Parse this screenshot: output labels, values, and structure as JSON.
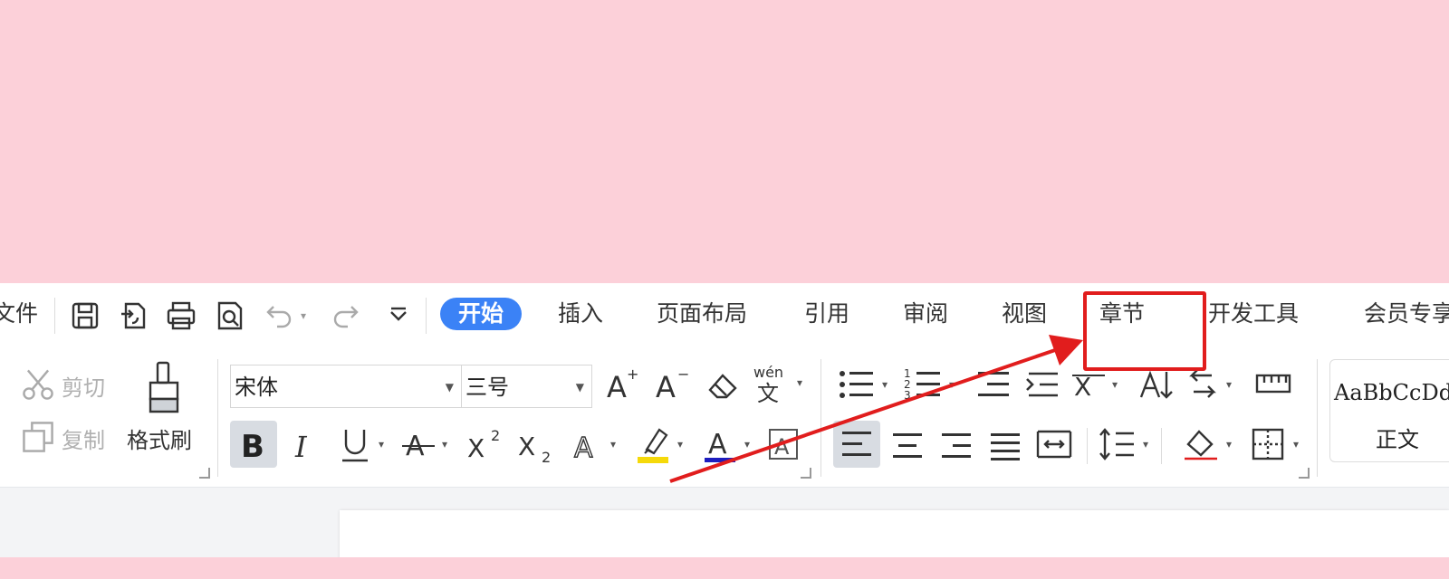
{
  "menu": {
    "file": "文件",
    "tabs": [
      "开始",
      "插入",
      "页面布局",
      "引用",
      "审阅",
      "视图",
      "章节",
      "开发工具",
      "会员专享"
    ],
    "active_tab": "开始"
  },
  "quick_access": {
    "icons": [
      "save-icon",
      "export-icon",
      "print-icon",
      "print-preview-icon",
      "undo-icon",
      "redo-icon",
      "customize-icon"
    ]
  },
  "clipboard": {
    "cut_label": "剪切",
    "copy_label": "复制",
    "format_painter_label": "格式刷"
  },
  "font": {
    "name": "宋体",
    "size": "三号",
    "pinyin_label": "wén"
  },
  "styles": {
    "sample_text": "AaBbCcDd",
    "normal_label": "正文"
  },
  "colors": {
    "accent": "#3b82f6",
    "highlight": "#e11d1d",
    "highlighter_yellow": "#f5d90a",
    "font_color_blue": "#1d1dbf"
  },
  "annotation": {
    "highlighted_tab": "章节"
  }
}
